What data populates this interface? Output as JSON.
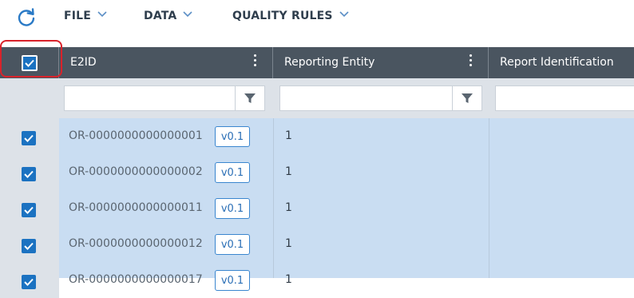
{
  "toolbar": {
    "refresh_icon": "refresh-icon",
    "menus": [
      {
        "label": "FILE"
      },
      {
        "label": "DATA"
      },
      {
        "label": "QUALITY RULES"
      }
    ]
  },
  "grid": {
    "columns": [
      {
        "label": "E2ID"
      },
      {
        "label": "Reporting Entity"
      },
      {
        "label": "Report Identification"
      }
    ],
    "select_all_checked": true,
    "rows": [
      {
        "id": "OR-0000000000000001",
        "version": "v0.1",
        "reporting_entity": "1",
        "checked": true
      },
      {
        "id": "OR-0000000000000002",
        "version": "v0.1",
        "reporting_entity": "1",
        "checked": true
      },
      {
        "id": "OR-0000000000000011",
        "version": "v0.1",
        "reporting_entity": "1",
        "checked": true
      },
      {
        "id": "OR-0000000000000012",
        "version": "v0.1",
        "reporting_entity": "1",
        "checked": true
      },
      {
        "id": "OR-0000000000000017",
        "version": "v0.1",
        "reporting_entity": "1",
        "checked": true
      }
    ]
  },
  "colors": {
    "accent": "#1b72c1",
    "header_bg": "#4a5560",
    "row_selected_bg": "#c9ddf2",
    "highlight": "#d9232b"
  }
}
